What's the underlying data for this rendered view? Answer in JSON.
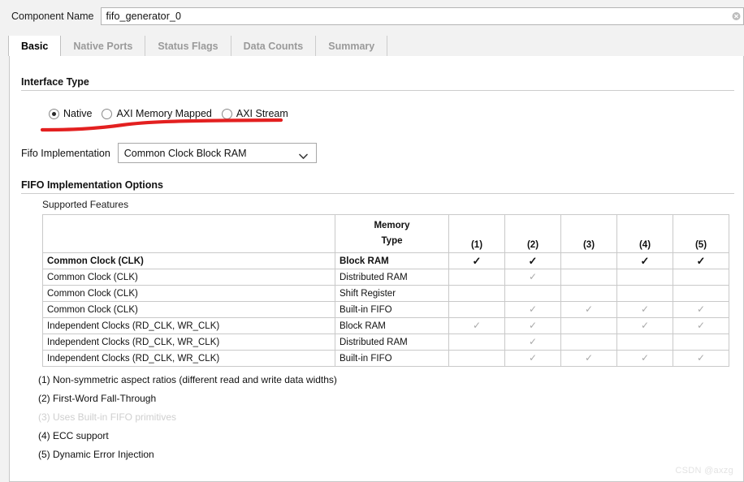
{
  "component_name": {
    "label": "Component Name",
    "value": "fifo_generator_0",
    "icon": "clear-icon"
  },
  "tabs": [
    {
      "label": "Basic",
      "active": true
    },
    {
      "label": "Native Ports",
      "active": false
    },
    {
      "label": "Status Flags",
      "active": false
    },
    {
      "label": "Data Counts",
      "active": false
    },
    {
      "label": "Summary",
      "active": false
    }
  ],
  "interface_type": {
    "heading": "Interface Type",
    "options": [
      {
        "label": "Native",
        "selected": true
      },
      {
        "label": "AXI Memory Mapped",
        "selected": false
      },
      {
        "label": "AXI Stream",
        "selected": false
      }
    ]
  },
  "fifo_implementation": {
    "label": "Fifo Implementation",
    "value": "Common Clock Block RAM",
    "chevron": "chevron-down-icon"
  },
  "fifo_options": {
    "heading": "FIFO Implementation Options",
    "supported_features_label": "Supported Features"
  },
  "table": {
    "headers": [
      "",
      "Memory\nType",
      "(1)",
      "(2)",
      "(3)",
      "(4)",
      "(5)"
    ],
    "header_blank": "",
    "header_memory_line1": "Memory",
    "header_memory_line2": "Type",
    "header_cols": [
      "(1)",
      "(2)",
      "(3)",
      "(4)",
      "(5)"
    ],
    "rows": [
      {
        "feature": "Common Clock (CLK)",
        "memory": "Block RAM",
        "marks": [
          "on",
          "on",
          "",
          "on",
          "on"
        ],
        "highlighted": true
      },
      {
        "feature": "Common Clock (CLK)",
        "memory": "Distributed RAM",
        "marks": [
          "",
          "dim",
          "",
          "",
          ""
        ],
        "highlighted": false
      },
      {
        "feature": "Common Clock (CLK)",
        "memory": "Shift Register",
        "marks": [
          "",
          "",
          "",
          "",
          ""
        ],
        "highlighted": false
      },
      {
        "feature": "Common Clock (CLK)",
        "memory": "Built-in FIFO",
        "marks": [
          "",
          "dim",
          "dim",
          "dim",
          "dim"
        ],
        "highlighted": false
      },
      {
        "feature": "Independent Clocks (RD_CLK, WR_CLK)",
        "memory": "Block RAM",
        "marks": [
          "dim",
          "dim",
          "",
          "dim",
          "dim"
        ],
        "highlighted": false
      },
      {
        "feature": "Independent Clocks (RD_CLK, WR_CLK)",
        "memory": "Distributed RAM",
        "marks": [
          "",
          "dim",
          "",
          "",
          ""
        ],
        "highlighted": false
      },
      {
        "feature": "Independent Clocks (RD_CLK, WR_CLK)",
        "memory": "Built-in FIFO",
        "marks": [
          "",
          "dim",
          "dim",
          "dim",
          "dim"
        ],
        "highlighted": false
      }
    ],
    "tick_glyph": "✓"
  },
  "footnotes": [
    {
      "text": "(1) Non-symmetric aspect ratios (different read and write data widths)",
      "muted": false
    },
    {
      "text": "(2) First-Word Fall-Through",
      "muted": false
    },
    {
      "text": "(3) Uses Built-in FIFO primitives",
      "muted": true
    },
    {
      "text": "(4) ECC support",
      "muted": false
    },
    {
      "text": "(5) Dynamic Error Injection",
      "muted": false
    }
  ],
  "watermark": "CSDN @axzg",
  "colors": {
    "annotation_red": "#e32020",
    "panel_bg": "#ffffff",
    "window_bg": "#f2f2f2",
    "tab_inactive_text": "#9a9a9a",
    "muted_text": "#cfcfcf"
  }
}
